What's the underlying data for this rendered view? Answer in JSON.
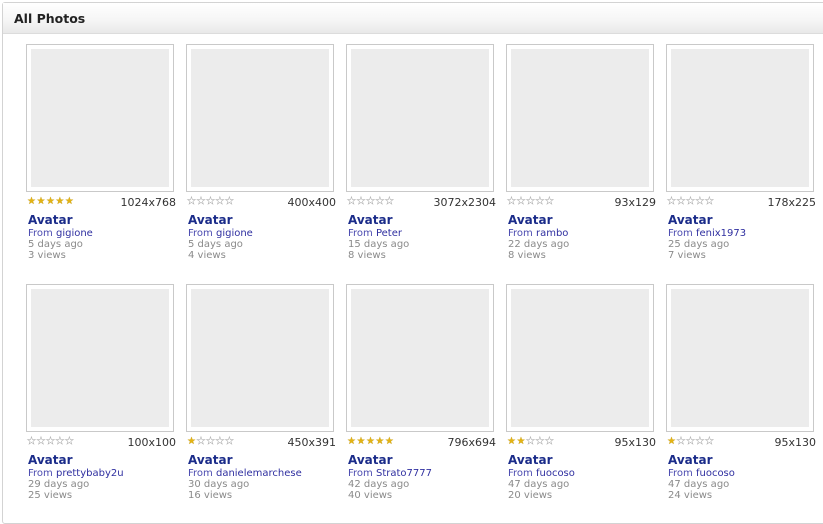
{
  "panel": {
    "title": "All Photos"
  },
  "photos": [
    {
      "title": "Avatar",
      "rating": 5,
      "dimensions": "1024x768",
      "from_label": "From",
      "user": "gigione",
      "age": "5 days ago",
      "views": "3 views"
    },
    {
      "title": "Avatar",
      "rating": 0,
      "dimensions": "400x400",
      "from_label": "From",
      "user": "gigione",
      "age": "5 days ago",
      "views": "4 views"
    },
    {
      "title": "Avatar",
      "rating": 0,
      "dimensions": "3072x2304",
      "from_label": "From",
      "user": "Peter",
      "age": "15 days ago",
      "views": "8 views"
    },
    {
      "title": "Avatar",
      "rating": 0,
      "dimensions": "93x129",
      "from_label": "From",
      "user": "rambo",
      "age": "22 days ago",
      "views": "8 views"
    },
    {
      "title": "Avatar",
      "rating": 0,
      "dimensions": "178x225",
      "from_label": "From",
      "user": "fenix1973",
      "age": "25 days ago",
      "views": "7 views"
    },
    {
      "title": "Avatar",
      "rating": 0,
      "dimensions": "100x100",
      "from_label": "From",
      "user": "prettybaby2u",
      "age": "29 days ago",
      "views": "25 views"
    },
    {
      "title": "Avatar",
      "rating": 1,
      "dimensions": "450x391",
      "from_label": "From",
      "user": "danielemarchese",
      "age": "30 days ago",
      "views": "16 views"
    },
    {
      "title": "Avatar",
      "rating": 5,
      "dimensions": "796x694",
      "from_label": "From",
      "user": "Strato7777",
      "age": "42 days ago",
      "views": "40 views"
    },
    {
      "title": "Avatar",
      "rating": 2,
      "dimensions": "95x130",
      "from_label": "From",
      "user": "fuocoso",
      "age": "47 days ago",
      "views": "20 views"
    },
    {
      "title": "Avatar",
      "rating": 1,
      "dimensions": "95x130",
      "from_label": "From",
      "user": "fuocoso",
      "age": "47 days ago",
      "views": "24 views"
    }
  ],
  "rating_max": 5,
  "colors": {
    "title_link": "#1b2c8a",
    "star_on": "#e3b313",
    "thumb_placeholder": "#ececec"
  }
}
